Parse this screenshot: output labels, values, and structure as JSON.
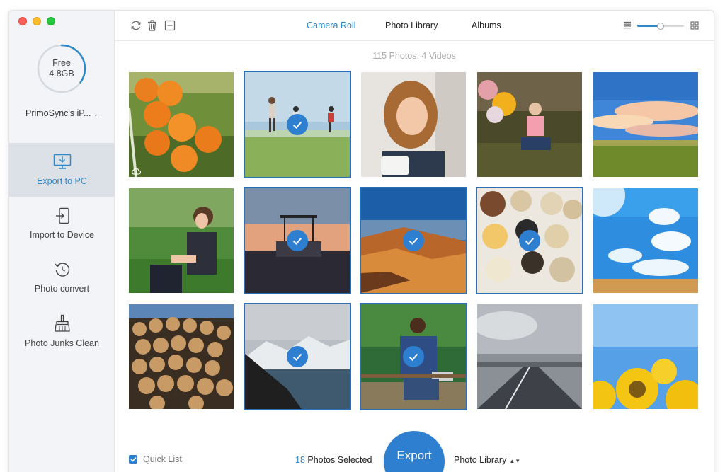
{
  "sidebar": {
    "storage": {
      "label": "Free",
      "value": "4.8GB",
      "used_fraction": 0.35
    },
    "device_name": "PrimoSync's iP...",
    "nav": [
      {
        "id": "export",
        "label": "Export to PC",
        "icon": "export-to-pc-icon",
        "active": true
      },
      {
        "id": "import",
        "label": "Import to Device",
        "icon": "import-to-device-icon",
        "active": false
      },
      {
        "id": "convert",
        "label": "Photo convert",
        "icon": "photo-convert-icon",
        "active": false
      },
      {
        "id": "clean",
        "label": "Photo Junks Clean",
        "icon": "broom-icon",
        "active": false
      }
    ]
  },
  "toolbar": {
    "tools": [
      "refresh-icon",
      "trash-icon",
      "collapse-icon"
    ],
    "tabs": [
      {
        "label": "Camera Roll",
        "active": true
      },
      {
        "label": "Photo Library",
        "active": false
      },
      {
        "label": "Albums",
        "active": false
      }
    ],
    "zoom_level": 0.5
  },
  "summary": "115 Photos, 4 Videos",
  "photos": [
    {
      "subject": "coconuts",
      "selected": false,
      "cloud": true
    },
    {
      "subject": "kids-running-on-beach",
      "selected": true,
      "cloud": false
    },
    {
      "subject": "girl-with-mug",
      "selected": false,
      "cloud": false
    },
    {
      "subject": "girl-with-balloons",
      "selected": false,
      "cloud": false
    },
    {
      "subject": "sunset-sky-over-field",
      "selected": false,
      "cloud": false
    },
    {
      "subject": "woman-reaching-hand",
      "selected": false,
      "cloud": false
    },
    {
      "subject": "beach-canopy-at-dusk",
      "selected": true,
      "cloud": false
    },
    {
      "subject": "coastal-rocks",
      "selected": true,
      "cloud": false
    },
    {
      "subject": "grains-and-spices",
      "selected": true,
      "cloud": false
    },
    {
      "subject": "blue-sky-with-clouds",
      "selected": false,
      "cloud": false
    },
    {
      "subject": "stacked-logs",
      "selected": false,
      "cloud": false
    },
    {
      "subject": "mountain-lake",
      "selected": true,
      "cloud": false
    },
    {
      "subject": "man-on-bench-with-tablet",
      "selected": true,
      "cloud": false
    },
    {
      "subject": "empty-road",
      "selected": false,
      "cloud": false
    },
    {
      "subject": "sunflowers",
      "selected": false,
      "cloud": false
    }
  ],
  "footer": {
    "quick_list_label": "Quick List",
    "quick_list_checked": true,
    "selected_count": "18",
    "selected_label": " Photos Selected",
    "export_label": "Export",
    "destination": "Photo Library"
  },
  "colors": {
    "accent": "#2f87c8",
    "selection": "#2c6fb5"
  }
}
